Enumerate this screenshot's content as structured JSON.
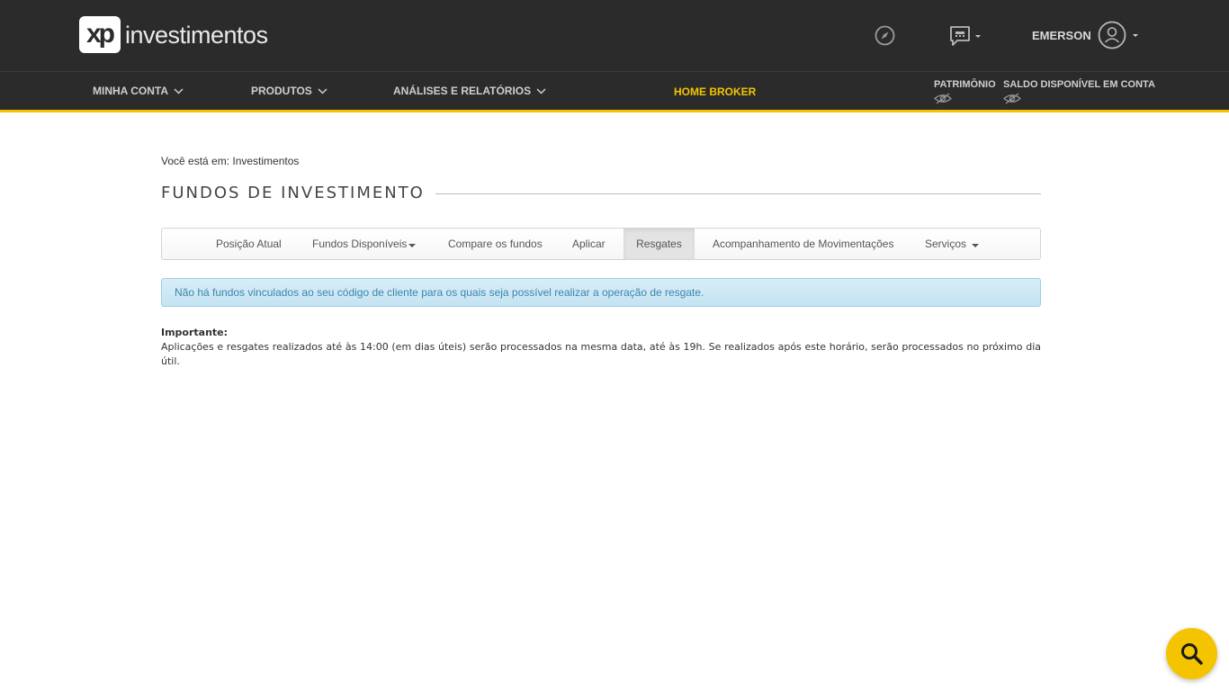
{
  "header": {
    "logo_mark": "xp",
    "logo_text": "investimentos",
    "icons": [
      "compass-icon",
      "chat-icon",
      "user-avatar-icon"
    ],
    "user_name": "EMERSON"
  },
  "nav": {
    "items": [
      {
        "label": "MINHA CONTA"
      },
      {
        "label": "PRODUTOS"
      },
      {
        "label": "ANÁLISES E RELATÓRIOS"
      }
    ],
    "home_broker": "HOME BROKER",
    "patrimonio": "PATRIMÔNIO",
    "saldo": "SALDO DISPONÍVEL EM CONTA"
  },
  "breadcrumb": "Você está em: Investimentos",
  "page_title": "FUNDOS DE INVESTIMENTO",
  "tabs": [
    {
      "label": "Posição Atual"
    },
    {
      "label": "Fundos Disponíveis"
    },
    {
      "label": "Compare os fundos"
    },
    {
      "label": "Aplicar"
    },
    {
      "label": "Resgates",
      "active": true
    },
    {
      "label": "Acompanhamento de Movimentações"
    },
    {
      "label": "Serviços"
    }
  ],
  "alert": "Não há fundos vinculados ao seu código de cliente para os quais seja possível realizar a operação de resgate.",
  "important": {
    "title": "Importante:",
    "text": "Aplicações e resgates realizados até às 14:00 (em dias úteis) serão processados na mesma data, até às 19h. Se realizados após este horário, serão processados no próximo dia útil."
  },
  "colors": {
    "header_bg": "#2b2b2b",
    "accent": "#f4c300",
    "alert_text": "#3a87ad"
  }
}
